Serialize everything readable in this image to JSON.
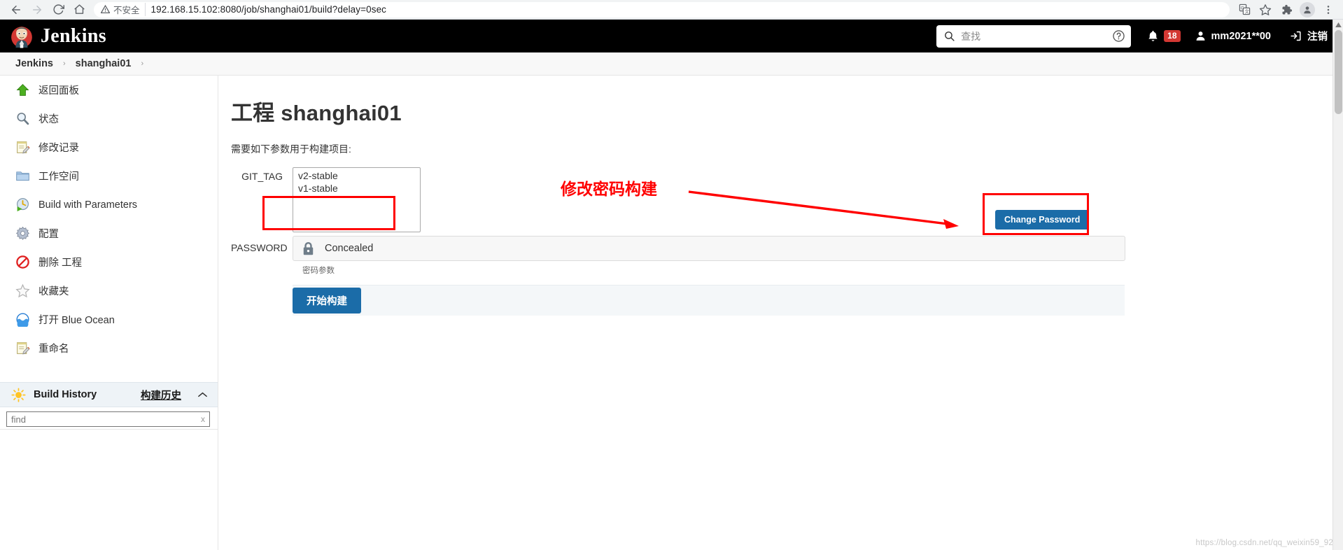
{
  "browser": {
    "back_icon": "back-arrow-icon",
    "forward_icon": "forward-arrow-icon",
    "reload_icon": "reload-icon",
    "home_icon": "home-icon",
    "security_label": "不安全",
    "url": "192.168.15.102:8080/job/shanghai01/build?delay=0sec",
    "icons": [
      "translate-icon",
      "bookmark-star-icon",
      "extensions-puzzle-icon",
      "profile-avatar-icon",
      "chrome-menu-icon"
    ]
  },
  "header": {
    "brand": "Jenkins",
    "search_placeholder": "查找",
    "search_icon": "search-icon",
    "help_icon": "help-circle-icon",
    "bell_icon": "bell-icon",
    "notification_count": "18",
    "user_icon": "user-icon",
    "user_name": "mm2021**00",
    "logout_icon": "logout-icon",
    "logout_label": "注销"
  },
  "breadcrumb": {
    "items": [
      "Jenkins",
      "shanghai01"
    ],
    "separator": "›"
  },
  "sidebar": {
    "items": [
      {
        "label": "返回面板",
        "icon": "up-arrow-icon"
      },
      {
        "label": "状态",
        "icon": "magnifier-icon"
      },
      {
        "label": "修改记录",
        "icon": "notepad-pencil-icon"
      },
      {
        "label": "工作空间",
        "icon": "folder-icon"
      },
      {
        "label": "Build with Parameters",
        "icon": "clock-play-icon"
      },
      {
        "label": "配置",
        "icon": "gear-icon"
      },
      {
        "label": "删除 工程",
        "icon": "delete-forbidden-icon"
      },
      {
        "label": "收藏夹",
        "icon": "star-icon"
      },
      {
        "label": "打开 Blue Ocean",
        "icon": "blue-ocean-icon"
      },
      {
        "label": "重命名",
        "icon": "notepad-pencil-icon"
      }
    ],
    "build_history": {
      "icon": "sun-icon",
      "title": "Build History",
      "link_label": "构建历史",
      "collapse_icon": "chevron-up-icon",
      "find_placeholder": "find",
      "find_value": "",
      "clear_label": "x"
    }
  },
  "main": {
    "page_title": "工程 shanghai01",
    "intro": "需要如下参数用于构建项目:",
    "params": [
      {
        "name": "GIT_TAG",
        "type": "select",
        "options": [
          "v2-stable",
          "v1-stable"
        ],
        "selected": "v2-stable"
      },
      {
        "name": "PASSWORD",
        "type": "password",
        "icon": "lock-icon",
        "value": "Concealed",
        "help": "密码参数"
      }
    ],
    "build_button": "开始构建"
  },
  "annotations": {
    "note_text": "修改密码构建",
    "note_color": "#ff0000",
    "change_password_button": "Change Password"
  },
  "watermark": "https://blog.csdn.net/qq_weixin59_92"
}
